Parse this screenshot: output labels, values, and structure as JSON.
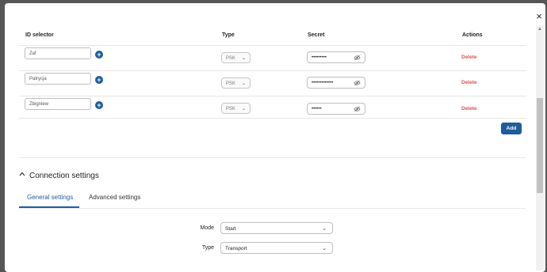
{
  "dialog": {
    "close_label": "×"
  },
  "table": {
    "headers": {
      "id": "ID selector",
      "type": "Type",
      "secret": "Secret",
      "actions": "Actions"
    },
    "rows": [
      {
        "id": "Zaf",
        "type": "PSK",
        "secret": "•••••••••",
        "action": "Delete"
      },
      {
        "id": "Patrycja",
        "type": "PSK",
        "secret": "•••••••••••••",
        "action": "Delete"
      },
      {
        "id": "Zbigniew",
        "type": "PSK",
        "secret": "••••••",
        "action": "Delete"
      }
    ],
    "add_label": "Add"
  },
  "connection": {
    "title": "Connection settings",
    "tabs": [
      "General settings",
      "Advanced settings"
    ],
    "active_tab": "General settings",
    "fields": [
      {
        "label": "Mode",
        "value": "Start"
      },
      {
        "label": "Type",
        "value": "Transport"
      }
    ]
  },
  "colors": {
    "accent": "#1d5d9b",
    "danger": "#d9534f",
    "backdrop": "#565656"
  },
  "icons": {
    "plus": "plus-circle-icon",
    "eye": "eye-slash-icon",
    "chevron": "chevron-down-icon",
    "close": "close-icon",
    "collapse": "chevron-up-icon"
  }
}
